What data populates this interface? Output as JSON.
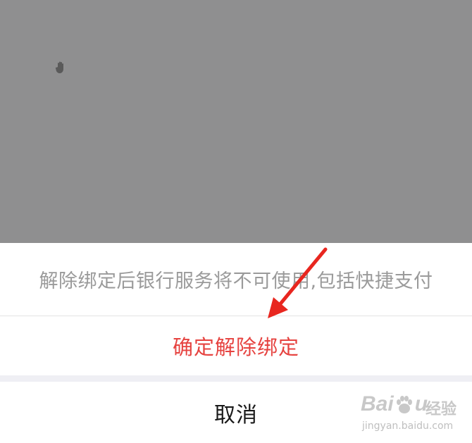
{
  "background": {
    "overlay_color": "#8f8f90",
    "cursor_icon": "hand-icon"
  },
  "action_sheet": {
    "message": "解除绑定后银行服务将不可使用,包括快捷支付",
    "confirm_label": "确定解除绑定",
    "cancel_label": "取消",
    "confirm_color": "#e64340",
    "message_color": "#9a9a9a"
  },
  "annotation": {
    "arrow_color": "#e8261f",
    "arrow_icon": "red-arrow-icon"
  },
  "watermark": {
    "brand": "Bai",
    "brand_suffix": "u",
    "service": "经验",
    "url": "jingyan.baidu.com"
  }
}
